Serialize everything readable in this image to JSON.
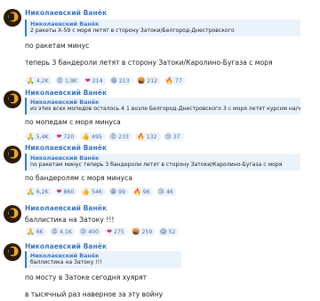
{
  "messages": [
    {
      "author": "Николаевский Ванёк",
      "reply": {
        "author": "Николаевский Ванёк",
        "text": "2 ракеты Х-59 с моря летят в сторону Затоки/Белгород-Днестровского"
      },
      "lines": [
        "по ракетам минус",
        "теперь 3 бандероли летят в сторону Затоки/Каролино-Бугаза с моря"
      ],
      "reactions": [
        {
          "emoji": "🙏",
          "count": "4,2K"
        },
        {
          "emoji": "😡",
          "count": "1,9K"
        },
        {
          "emoji": "❤",
          "count": "214"
        },
        {
          "emoji": "😁",
          "count": "213"
        },
        {
          "emoji": "🤬",
          "count": "212"
        },
        {
          "emoji": "🔥",
          "count": "77"
        }
      ]
    },
    {
      "author": "Николаевский Ванёк",
      "reply": {
        "author": "Николаевский Ванёк",
        "text": "из этих всех мопедов осталось 4  1 возле Белгород-Днестровского  3 с моря летят курсом на/череэ..."
      },
      "lines": [
        "по мопедам с моря минуса"
      ],
      "reactions": [
        {
          "emoji": "🙏",
          "count": "5,4K"
        },
        {
          "emoji": "❤",
          "count": "720"
        },
        {
          "emoji": "👍",
          "count": "495"
        },
        {
          "emoji": "😡",
          "count": "233"
        },
        {
          "emoji": "🔥",
          "count": "132"
        },
        {
          "emoji": "😢",
          "count": "37"
        }
      ]
    },
    {
      "author": "Николаевский Ванёк",
      "reply": {
        "author": "Николаевский Ванёк",
        "text": "по ракетам минус  теперь 3 бандероли летят в сторону Затоки/Каролино-Бугаза с моря"
      },
      "lines": [
        "по бандеролям с моря минуса"
      ],
      "reactions": [
        {
          "emoji": "🙏",
          "count": "6,2K"
        },
        {
          "emoji": "❤",
          "count": "860"
        },
        {
          "emoji": "👍",
          "count": "546"
        },
        {
          "emoji": "😁",
          "count": "99"
        },
        {
          "emoji": "🔥",
          "count": "96"
        },
        {
          "emoji": "😢",
          "count": "46"
        }
      ]
    },
    {
      "author": "Николаевский Ванёк",
      "reply": null,
      "lines": [
        "баллистика на Затоку !!!"
      ],
      "reactions": [
        {
          "emoji": "🙏",
          "count": "6K"
        },
        {
          "emoji": "😡",
          "count": "4,1K"
        },
        {
          "emoji": "😢",
          "count": "400"
        },
        {
          "emoji": "❤",
          "count": "275"
        },
        {
          "emoji": "🤬",
          "count": "259"
        },
        {
          "emoji": "😱",
          "count": "52"
        }
      ]
    },
    {
      "author": "Николаевский Ванёк",
      "reply": {
        "author": "Николаевский Ванёк",
        "text": "баллистика на Затоку !!!"
      },
      "lines": [
        "по мосту в Затоке сегодня хуярят",
        "в тысячный раз наверное за эту войну"
      ],
      "reactions": []
    }
  ]
}
